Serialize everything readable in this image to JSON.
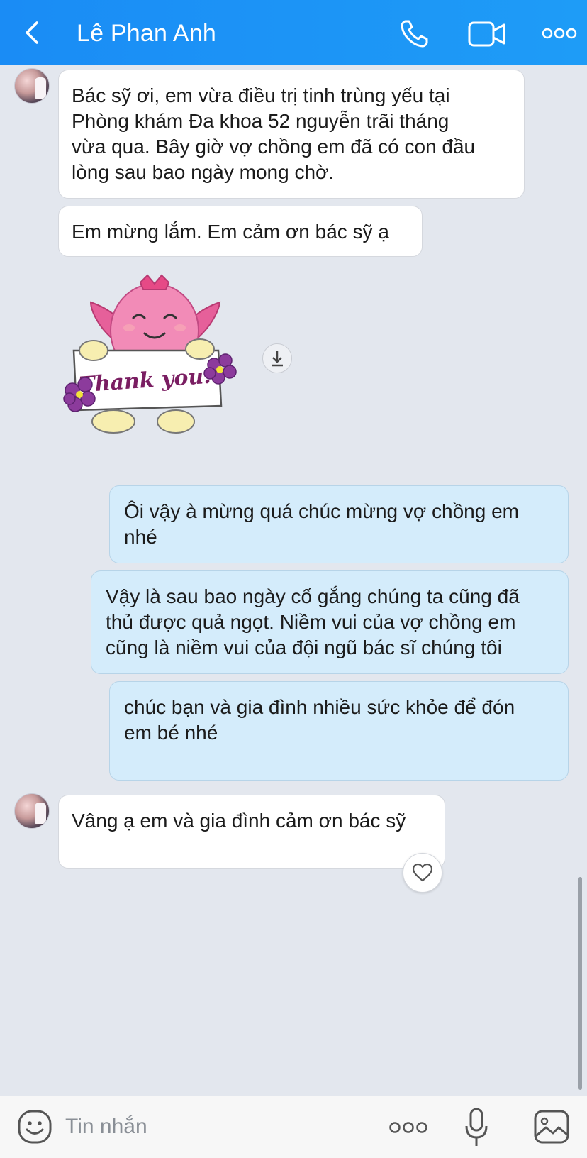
{
  "header": {
    "title": "Lê Phan Anh",
    "back_icon": "chevron-left-icon",
    "call_icon": "phone-icon",
    "video_icon": "video-camera-icon",
    "more_icon": "more-dots-icon"
  },
  "messages": [
    {
      "direction": "in",
      "text": "Bác sỹ ơi, em vừa điều trị tinh trùng yếu tại\nPhòng khám Đa khoa 52 nguyễn trãi tháng\nvừa qua. Bây giờ vợ chồng em đã có con đầu\nlòng sau bao ngày mong chờ."
    },
    {
      "direction": "in",
      "text": "Em mừng lắm. Em cảm ơn bác sỹ ạ"
    },
    {
      "direction": "in",
      "type": "sticker",
      "sticker_text": "Thank you!"
    },
    {
      "direction": "out",
      "text": "Ôi vậy à mừng quá chúc mừng vợ chồng em\nnhé"
    },
    {
      "direction": "out",
      "text": "Vậy là sau bao ngày cố gắng chúng ta cũng đã\nthủ được quả ngọt. Niềm vui của vợ chồng em\ncũng là niềm vui của đội ngũ bác sĩ chúng tôi"
    },
    {
      "direction": "out",
      "text": "chúc bạn và gia đình nhiều sức khỏe để đón\nem bé nhé"
    },
    {
      "direction": "in",
      "text": "Vâng ạ em và gia đình cảm ơn bác sỹ"
    }
  ],
  "composer": {
    "placeholder": "Tin nhắn",
    "emoji_icon": "emoji-icon",
    "more_icon": "more-dots-icon",
    "mic_icon": "microphone-icon",
    "image_icon": "image-icon"
  },
  "colors": {
    "header": "#1a8cf5",
    "background": "#e3e7ee",
    "bubble_in": "#ffffff",
    "bubble_out": "#d4ecfb"
  }
}
